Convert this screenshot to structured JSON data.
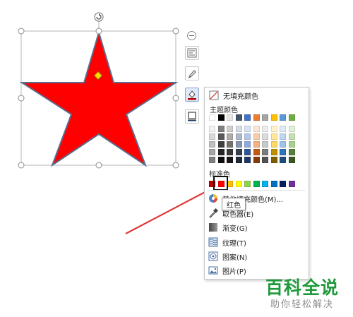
{
  "fill_menu": {
    "no_fill": "无填充颜色",
    "theme_colors_title": "主题颜色",
    "standard_colors_title": "标准色",
    "more_fill_colors": "其他填充颜色(M)...",
    "eyedropper": "取色器(E)",
    "gradient": "渐变(G)",
    "texture": "纹理(T)",
    "pattern": "图案(N)",
    "picture": "图片(P)",
    "theme_top_row": [
      "#ffffff",
      "#000000",
      "#e7e6e6",
      "#44546a",
      "#4472c4",
      "#ed7d31",
      "#a5a5a5",
      "#ffc000",
      "#5b9bd5",
      "#70ad47"
    ],
    "theme_columns": [
      [
        "#f2f2f2",
        "#d9d9d9",
        "#bfbfbf",
        "#a6a6a6",
        "#808080"
      ],
      [
        "#808080",
        "#595959",
        "#404040",
        "#262626",
        "#0d0d0d"
      ],
      [
        "#d0cece",
        "#aeabab",
        "#757171",
        "#3a3838",
        "#171616"
      ],
      [
        "#d6dce4",
        "#adb9ca",
        "#8497b0",
        "#333f4f",
        "#222a35"
      ],
      [
        "#d9e2f3",
        "#b4c7e7",
        "#8faadc",
        "#2f5597",
        "#1f3864"
      ],
      [
        "#fbe5d6",
        "#f8cbad",
        "#f4b183",
        "#c55a11",
        "#843c0c"
      ],
      [
        "#ededed",
        "#dbdbdb",
        "#c9c9c9",
        "#7b7b7b",
        "#525252"
      ],
      [
        "#fff2cc",
        "#ffe699",
        "#ffd966",
        "#bf9000",
        "#7f6000"
      ],
      [
        "#deebf7",
        "#bdd7ee",
        "#9dc3e6",
        "#2e75b6",
        "#1f4e79"
      ],
      [
        "#e2f0d9",
        "#c5e0b4",
        "#a9d18e",
        "#548235",
        "#385723"
      ]
    ],
    "standard_colors": [
      "#c00000",
      "#ff0000",
      "#ffc000",
      "#ffff00",
      "#92d050",
      "#00b050",
      "#00b0f0",
      "#0070c0",
      "#002060",
      "#7030a0"
    ]
  },
  "tooltip": "红色",
  "star": {
    "fill": "#ff0000",
    "stroke": "#5a6d8c"
  },
  "accent": "#e03a3a",
  "side_tools": [
    "layout-options-icon",
    "shape-style-icon",
    "shape-fill-icon",
    "shape-outline-icon"
  ],
  "watermark": {
    "title": "百科全说",
    "subtitle": "助你轻松解决"
  }
}
